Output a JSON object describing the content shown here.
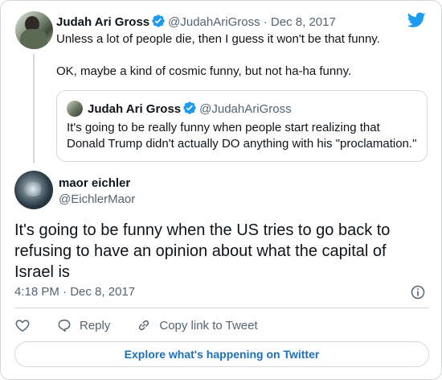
{
  "colors": {
    "brand": "#1d9bf0",
    "link": "#1d6fb8",
    "muted": "#536471",
    "border": "#cfd9de"
  },
  "parent_tweet": {
    "name": "Judah Ari Gross",
    "handle": "@JudahAriGross",
    "separator": "·",
    "date": "Dec 8, 2017",
    "line1": "Unless a lot of people die, then I guess it won't be that funny.",
    "line2": "OK, maybe a kind of cosmic funny, but not ha-ha funny."
  },
  "quoted_tweet": {
    "name": "Judah Ari Gross",
    "handle": "@JudahAriGross",
    "text": "It's going to be really funny when people start realizing that Donald Trump didn't actually DO anything with his \"proclamation.\""
  },
  "main_tweet": {
    "name": "maor eichler",
    "handle": "@EichlerMaor",
    "text": "It's going to be funny when the US tries to go back to refusing to have an opinion about what the capital of Israel is",
    "time": "4:18 PM",
    "separator": "·",
    "date": "Dec 8, 2017"
  },
  "actions": {
    "like_icon": "heart-icon",
    "reply_label": "Reply",
    "copy_label": "Copy link to Tweet"
  },
  "explore_label": "Explore what's happening on Twitter"
}
